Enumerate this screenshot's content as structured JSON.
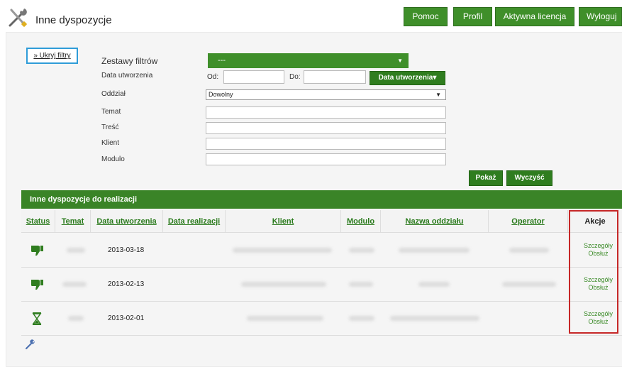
{
  "header": {
    "title": "Inne dyspozycje",
    "buttons": [
      "Pomoc",
      "Profil",
      "Aktywna licencja",
      "Wyloguj"
    ]
  },
  "filters": {
    "hide_label": "» Ukryj filtry",
    "filter_sets_label": "Zestawy filtrów",
    "filter_sets_value": "---",
    "created_label": "Data utworzenia",
    "from_label": "Od:",
    "to_label": "Do:",
    "created_button": "Data utworzenia▾",
    "branch_label": "Oddział",
    "branch_value": "Dowolny",
    "subject_label": "Temat",
    "content_label": "Treść",
    "client_label": "Klient",
    "module_label": "Modulo",
    "show_button": "Pokaż",
    "clear_button": "Wyczyść"
  },
  "table": {
    "title": "Inne dyspozycje do realizacji",
    "columns": [
      "Status",
      "Temat",
      "Data utworzenia",
      "Data realizacji",
      "Klient",
      "Modulo",
      "Nazwa oddziału",
      "Operator",
      "Akcje"
    ],
    "rows": [
      {
        "status": "thumbs-down",
        "created": "2013-03-18",
        "details": "Szczegóły",
        "handle": "Obsłuż"
      },
      {
        "status": "thumbs-down",
        "created": "2013-02-13",
        "details": "Szczegóły",
        "handle": "Obsłuż"
      },
      {
        "status": "hourglass",
        "created": "2013-02-01",
        "details": "Szczegóły",
        "handle": "Obsłuż"
      }
    ]
  },
  "colors": {
    "green": "#3f8f2a",
    "dark_green": "#2f7d1f",
    "link_green": "#2a7a1c",
    "highlight_red": "#c62828",
    "focus_blue": "#2f9cd8"
  }
}
